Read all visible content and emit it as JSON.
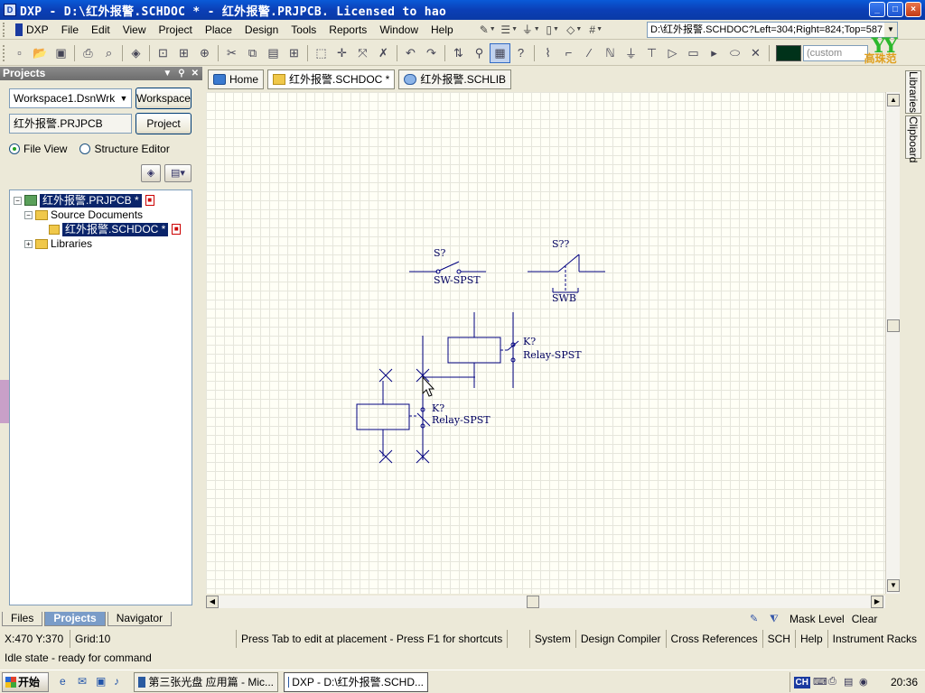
{
  "titlebar": {
    "title": "DXP - D:\\红外报警.SCHDOC * - 红外报警.PRJPCB. Licensed to hao",
    "btn_min": "_",
    "btn_max": "□",
    "btn_close": "×"
  },
  "menu": {
    "dxp": "DXP",
    "file": "File",
    "edit": "Edit",
    "view": "View",
    "project": "Project",
    "place": "Place",
    "design": "Design",
    "tools": "Tools",
    "reports": "Reports",
    "window": "Window",
    "help": "Help"
  },
  "path_combo": {
    "value": "D:\\红外报警.SCHDOC?Left=304;Right=824;Top=587"
  },
  "toolbar2": {
    "custom_placeholder": "(custom"
  },
  "brand": {
    "logo": "YY",
    "sub": "高珠范"
  },
  "projects_panel": {
    "title": "Projects",
    "workspace_combo": "Workspace1.DsnWrk",
    "workspace_button": "Workspace",
    "project_field": "红外报警.PRJPCB",
    "project_button": "Project",
    "radio_file_view": "File View",
    "radio_structure": "Structure Editor",
    "tree": {
      "project": "红外报警.PRJPCB *",
      "source_documents": "Source Documents",
      "schdoc": "红外报警.SCHDOC *",
      "libraries": "Libraries"
    }
  },
  "bottom_tabs": {
    "files": "Files",
    "projects": "Projects",
    "navigator": "Navigator"
  },
  "doc_tabs": {
    "home": "Home",
    "schdoc": "红外报警.SCHDOC *",
    "schlib": "红外报警.SCHLIB"
  },
  "schematic": {
    "sw1_designator": "S?",
    "sw1_comment": "SW-SPST",
    "sw2_designator": "S??",
    "sw2_comment": "SWB",
    "relay1_designator": "K?",
    "relay1_comment": "Relay-SPST",
    "relay2_designator": "K?",
    "relay2_comment": "Relay-SPST"
  },
  "right_tabs": {
    "libraries": "Libraries",
    "clipboard": "Clipboard"
  },
  "maskbar": {
    "mask_level": "Mask Level",
    "clear": "Clear"
  },
  "status": {
    "coords": "X:470 Y:370",
    "grid": "Grid:10",
    "hint": "Press Tab to edit at placement - Press F1 for shortcuts",
    "idle": "Idle state - ready for command",
    "system": "System",
    "design_compiler": "Design Compiler",
    "cross_ref": "Cross References",
    "sch": "SCH",
    "help": "Help",
    "instrument": "Instrument Racks"
  },
  "taskbar": {
    "start": "开始",
    "task1": "第三张光盘 应用篇 - Mic...",
    "task2": "DXP - D:\\红外报警.SCHD...",
    "ime": "CH",
    "clock": "20:36"
  }
}
